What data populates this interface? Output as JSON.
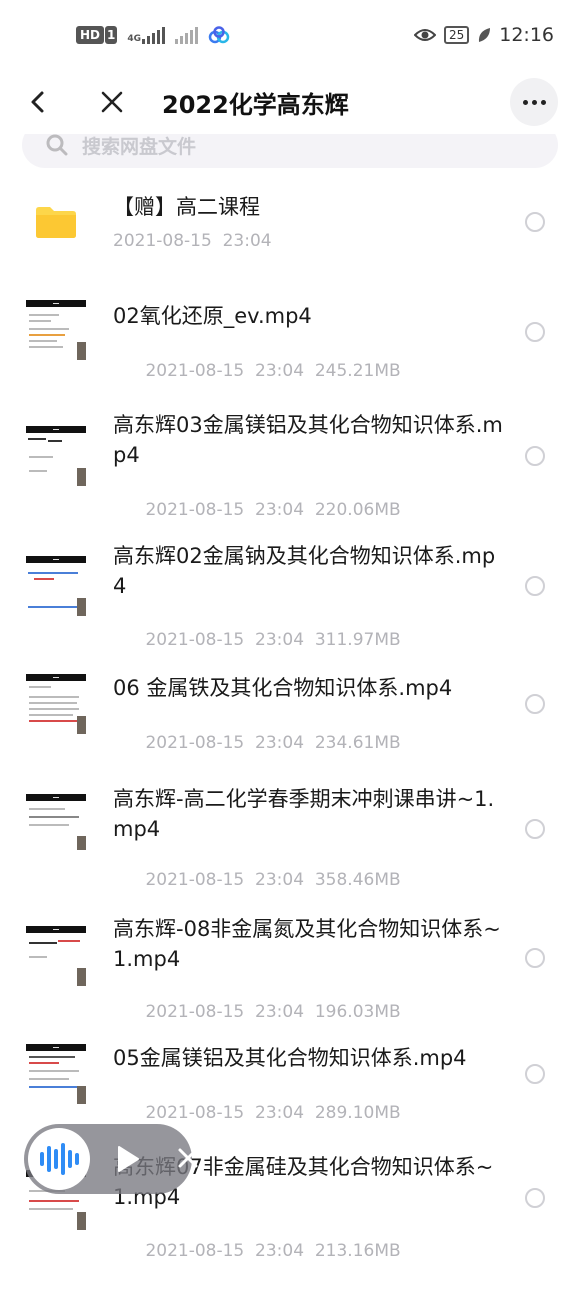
{
  "status_bar": {
    "hd_badge": "HD",
    "hd_sub": "1",
    "network_label": "4G",
    "battery": "25",
    "time": "12:16"
  },
  "header": {
    "title": "2022化学高东辉"
  },
  "search": {
    "placeholder": "搜索网盘文件"
  },
  "files": [
    {
      "name": "【赠】高二课程",
      "date": "2021-08-15  23:04",
      "size": "",
      "type": "folder"
    },
    {
      "name": "02氧化还原_ev.mp4",
      "date": "2021-08-15  23:04",
      "size": "245.21MB",
      "type": "video"
    },
    {
      "name": "高东辉03金属镁铝及其化合物知识体系.mp4",
      "date": "2021-08-15  23:04",
      "size": "220.06MB",
      "type": "video"
    },
    {
      "name": "高东辉02金属钠及其化合物知识体系.mp4",
      "date": "2021-08-15  23:04",
      "size": "311.97MB",
      "type": "video"
    },
    {
      "name": "06 金属铁及其化合物知识体系.mp4",
      "date": "2021-08-15  23:04",
      "size": "234.61MB",
      "type": "video"
    },
    {
      "name": "高东辉-高二化学春季期末冲刺课串讲~1.mp4",
      "date": "2021-08-15  23:04",
      "size": "358.46MB",
      "type": "video"
    },
    {
      "name": "高东辉-08非金属氮及其化合物知识体系~1.mp4",
      "date": "2021-08-15  23:04",
      "size": "196.03MB",
      "type": "video"
    },
    {
      "name": "05金属镁铝及其化合物知识体系.mp4",
      "date": "2021-08-15  23:04",
      "size": "289.10MB",
      "type": "video"
    },
    {
      "name": "高东辉07非金属硅及其化合物知识体系~1.mp4",
      "date": "2021-08-15  23:04",
      "size": "213.16MB",
      "type": "video"
    }
  ],
  "colors": {
    "folder": "#fdd64a",
    "accent": "#2f8cf5",
    "meta_text": "#b3b3b8"
  }
}
